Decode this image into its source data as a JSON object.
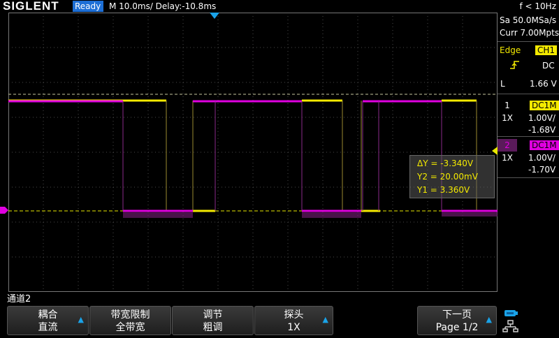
{
  "header": {
    "brand": "SIGLENT",
    "status": "Ready",
    "timebase": "M 10.0ms/ Delay:-10.8ms",
    "trigger_frequency": "f < 10Hz"
  },
  "acquisition": {
    "sample_rate": "Sa 50.0MSa/s",
    "memory_depth": "Curr 7.00Mpts"
  },
  "trigger": {
    "type_label": "Edge",
    "source": "CH1",
    "coupling": "DC",
    "level_label": "L",
    "level_value": "1.66 V"
  },
  "channels": [
    {
      "number": "1",
      "coupling": "DC1M",
      "probe": "1X",
      "scale": "1.00V/",
      "offset": "-1.68V",
      "color": "#f4ea00"
    },
    {
      "number": "2",
      "coupling": "DC1M",
      "probe": "1X",
      "scale": "1.00V/",
      "offset": "-1.70V",
      "color": "#e000e0"
    }
  ],
  "cursor_measurement": {
    "delta_y": "ΔY = -3.340V",
    "y2": "Y2 = 20.00mV",
    "y1": "Y1 = 3.360V"
  },
  "menu": {
    "channel_label": "通道2",
    "softkeys": [
      {
        "title": "耦合",
        "value": "直流",
        "has_arrow": true
      },
      {
        "title": "带宽限制",
        "value": "全带宽",
        "has_arrow": false
      },
      {
        "title": "调节",
        "value": "粗调",
        "has_arrow": false
      },
      {
        "title": "探头",
        "value": "1X",
        "has_arrow": true
      },
      {
        "title": "下一页",
        "value": "Page 1/2",
        "has_arrow": true
      }
    ]
  },
  "colors": {
    "ch1": "#f4ea00",
    "ch2": "#e000e0",
    "accent": "#1aa3e8",
    "grid": "#5a5a5a"
  },
  "icons": [
    "trigger-position-icon",
    "trigger-level-icon",
    "rising-edge-icon",
    "usb-icon",
    "network-icon"
  ]
}
